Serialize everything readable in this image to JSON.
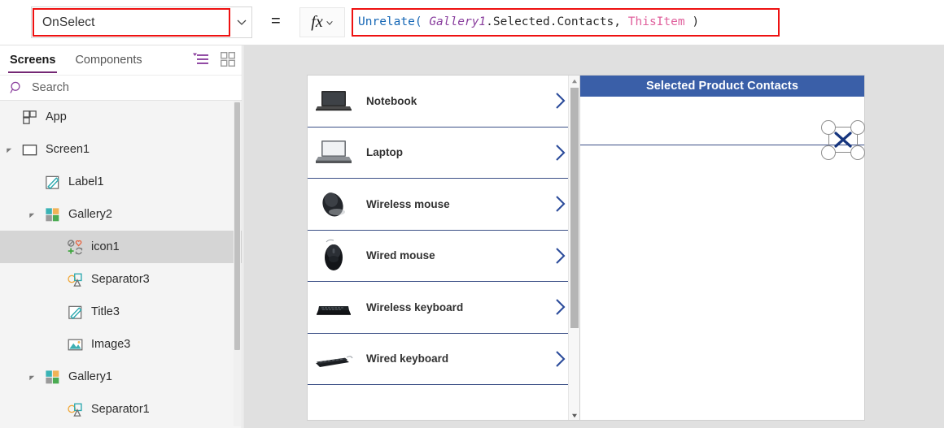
{
  "formula_bar": {
    "property_value": "OnSelect",
    "equals": "=",
    "fx_label": "fx",
    "formula_tokens": [
      {
        "text": "Unrelate(",
        "type": "fn"
      },
      {
        "text": " ",
        "type": "punct"
      },
      {
        "text": "Gallery1",
        "type": "ctrl"
      },
      {
        "text": ".Selected.Contacts,",
        "type": "prop"
      },
      {
        "text": " ",
        "type": "punct"
      },
      {
        "text": "ThisItem",
        "type": "thisitem"
      },
      {
        "text": " )",
        "type": "punct"
      }
    ],
    "formula_plain": "Unrelate( Gallery1.Selected.Contacts, ThisItem )",
    "highlight_color": "#ee1111",
    "chevron_icon": "chevron-down-icon",
    "fx_chevron_icon": "chevron-down-icon"
  },
  "tree_pane": {
    "tabs": [
      {
        "label": "Screens",
        "active": true
      },
      {
        "label": "Components",
        "active": false
      }
    ],
    "toolbar_icons": [
      {
        "name": "filter-list-icon",
        "color": "#8a3f9e"
      },
      {
        "name": "grid-view-icon",
        "color": "#9b9b9b"
      }
    ],
    "search": {
      "placeholder": "Search",
      "icon": "search-icon",
      "icon_color": "#8a3f9e"
    },
    "accent_color": "#742774",
    "items": [
      {
        "label": "App",
        "indent": 0,
        "icon": "app-icon",
        "caret": "none",
        "selected": false
      },
      {
        "label": "Screen1",
        "indent": 0,
        "icon": "screen-icon",
        "caret": "expanded",
        "selected": false
      },
      {
        "label": "Label1",
        "indent": 1,
        "icon": "label-icon",
        "caret": "none",
        "selected": false
      },
      {
        "label": "Gallery2",
        "indent": 1,
        "icon": "gallery-icon",
        "caret": "expanded",
        "selected": false
      },
      {
        "label": "icon1",
        "indent": 2,
        "icon": "icon-set-icon",
        "caret": "none",
        "selected": true
      },
      {
        "label": "Separator3",
        "indent": 2,
        "icon": "separator-icon",
        "caret": "none",
        "selected": false
      },
      {
        "label": "Title3",
        "indent": 2,
        "icon": "label-icon",
        "caret": "none",
        "selected": false
      },
      {
        "label": "Image3",
        "indent": 2,
        "icon": "image-icon",
        "caret": "none",
        "selected": false
      },
      {
        "label": "Gallery1",
        "indent": 1,
        "icon": "gallery-icon",
        "caret": "expanded",
        "selected": false
      },
      {
        "label": "Separator1",
        "indent": 2,
        "icon": "separator-icon",
        "caret": "none",
        "selected": false
      }
    ]
  },
  "canvas": {
    "background": "#e0e0e0",
    "gallery1": {
      "name": "product-gallery",
      "separator_color": "#3b4f86",
      "chevron_color": "#2b4b9b",
      "items": [
        {
          "title": "Notebook",
          "image": "notebook-thumbnail",
          "chevron": "chevron-right-icon"
        },
        {
          "title": "Laptop",
          "image": "laptop-thumbnail",
          "chevron": "chevron-right-icon"
        },
        {
          "title": "Wireless mouse",
          "image": "wireless-mouse-thumbnail",
          "chevron": "chevron-right-icon"
        },
        {
          "title": "Wired mouse",
          "image": "wired-mouse-thumbnail",
          "chevron": "chevron-right-icon"
        },
        {
          "title": "Wireless keyboard",
          "image": "wireless-keyboard-thumbnail",
          "chevron": "chevron-right-icon"
        },
        {
          "title": "Wired keyboard",
          "image": "wired-keyboard-thumbnail",
          "chevron": "chevron-right-icon"
        }
      ],
      "scrollbar": {
        "up_icon": "scroll-up-arrow-icon",
        "down_icon": "scroll-down-arrow-icon"
      }
    },
    "gallery2": {
      "name": "contacts-gallery",
      "header_title": "Selected Product Contacts",
      "header_color": "#3a5fa8",
      "header_text_color": "#ffffff",
      "separator_color": "#3b4f86",
      "selected_control": {
        "name": "icon1",
        "icon": "cancel-x-icon",
        "icon_color": "#16357e",
        "handle_count": 4
      }
    }
  }
}
